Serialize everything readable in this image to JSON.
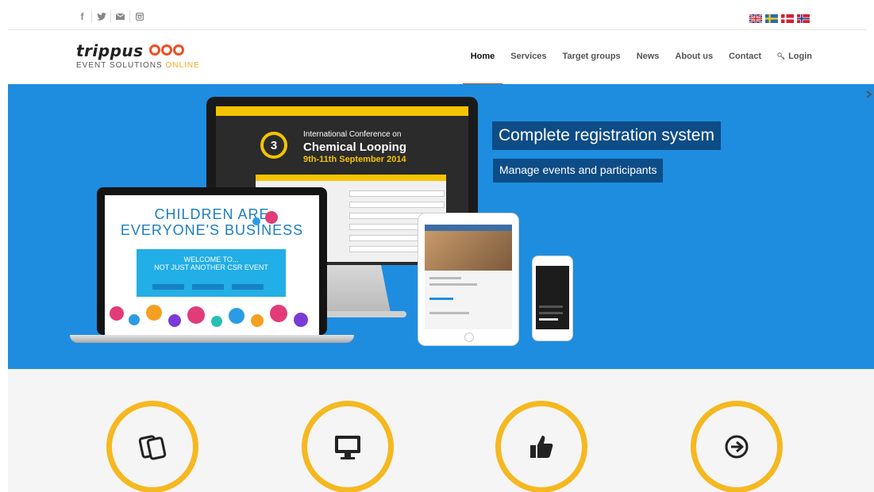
{
  "topbar": {
    "social": [
      {
        "icon": "facebook-icon",
        "glyph": "f"
      },
      {
        "icon": "twitter-icon",
        "glyph": ""
      },
      {
        "icon": "mail-icon",
        "glyph": ""
      },
      {
        "icon": "instagram-icon",
        "glyph": ""
      }
    ],
    "flags": [
      {
        "icon": "uk-flag-icon"
      },
      {
        "icon": "sweden-flag-icon"
      },
      {
        "icon": "denmark-flag-icon"
      },
      {
        "icon": "norway-flag-icon"
      }
    ]
  },
  "header": {
    "logo_word": "trippus",
    "logo_sub": "EVENT SOLUTIONS",
    "logo_online": "ONLINE",
    "nav": [
      {
        "label": "Home",
        "active": true
      },
      {
        "label": "Services"
      },
      {
        "label": "Target groups"
      },
      {
        "label": "News"
      },
      {
        "label": "About us"
      },
      {
        "label": "Contact"
      },
      {
        "label": "Login",
        "icon": "key-icon"
      }
    ]
  },
  "hero": {
    "headline": "Complete registration system",
    "subline": "Manage events and participants",
    "monitor": {
      "badge": "3",
      "line1": "International Conference on",
      "line2": "Chemical Looping",
      "line3": "9th-11th September 2014"
    },
    "laptop": {
      "title1": "CHILDREN ARE",
      "title2": "EVERYONE'S BUSINESS",
      "welcome1": "WELCOME TO...",
      "welcome2": "NOT JUST ANOTHER CSR EVENT"
    }
  },
  "features": [
    {
      "icon": "cards-icon"
    },
    {
      "icon": "monitor-icon"
    },
    {
      "icon": "thumbs-up-icon"
    },
    {
      "icon": "arrow-circle-right-icon"
    }
  ],
  "colors": {
    "hero_blue": "#1e8de0",
    "tag_navy": "#0d4c86",
    "accent_orange": "#f04e23",
    "ring_yellow": "#f5b820",
    "nav_active_underline": "#c0542b"
  }
}
